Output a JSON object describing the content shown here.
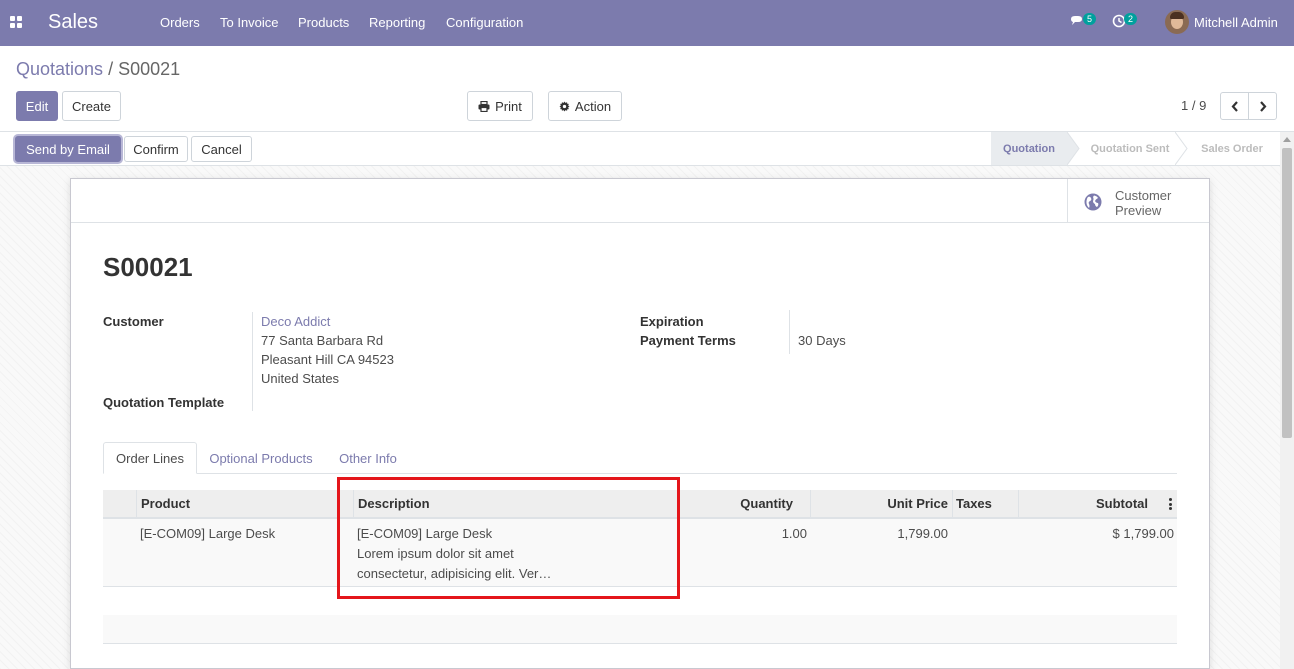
{
  "navbar": {
    "app_name": "Sales",
    "menu": [
      "Orders",
      "To Invoice",
      "Products",
      "Reporting",
      "Configuration"
    ],
    "chat_count": "5",
    "activity_count": "2",
    "user_name": "Mitchell Admin",
    "color": "#7c7bad"
  },
  "breadcrumb": {
    "parent": "Quotations",
    "separator": "/",
    "current": "S00021"
  },
  "toolbar": {
    "edit_label": "Edit",
    "create_label": "Create",
    "print_label": "Print",
    "action_label": "Action",
    "pager_value": "1 / 9"
  },
  "statusbar": {
    "send_email_label": "Send by Email",
    "confirm_label": "Confirm",
    "cancel_label": "Cancel",
    "stages": [
      "Quotation",
      "Quotation Sent",
      "Sales Order"
    ],
    "active_stage": "Quotation"
  },
  "sheet": {
    "customer_preview_line1": "Customer",
    "customer_preview_line2": "Preview",
    "record_name": "S00021",
    "fields": {
      "customer_label": "Customer",
      "customer_name": "Deco Addict",
      "address_line1": "77 Santa Barbara Rd",
      "address_line2": "Pleasant Hill CA 94523",
      "address_line3": "United States",
      "quotation_template_label": "Quotation Template",
      "expiration_label": "Expiration",
      "payment_terms_label": "Payment Terms",
      "payment_terms_value": "30 Days"
    },
    "tabs": [
      "Order Lines",
      "Optional Products",
      "Other Info"
    ],
    "active_tab": "Order Lines"
  },
  "order_lines": {
    "columns": {
      "product": "Product",
      "description": "Description",
      "quantity": "Quantity",
      "unit_price": "Unit Price",
      "taxes": "Taxes",
      "subtotal": "Subtotal"
    },
    "rows": [
      {
        "product": "[E-COM09] Large Desk",
        "description_line1": "[E-COM09] Large Desk",
        "description_line2": "Lorem ipsum dolor sit amet",
        "description_line3": "consectetur, adipisicing elit. Ver…",
        "quantity": "1.00",
        "unit_price": "1,799.00",
        "taxes": "",
        "subtotal": "$ 1,799.00"
      }
    ]
  },
  "highlight_color": "#e4161b"
}
